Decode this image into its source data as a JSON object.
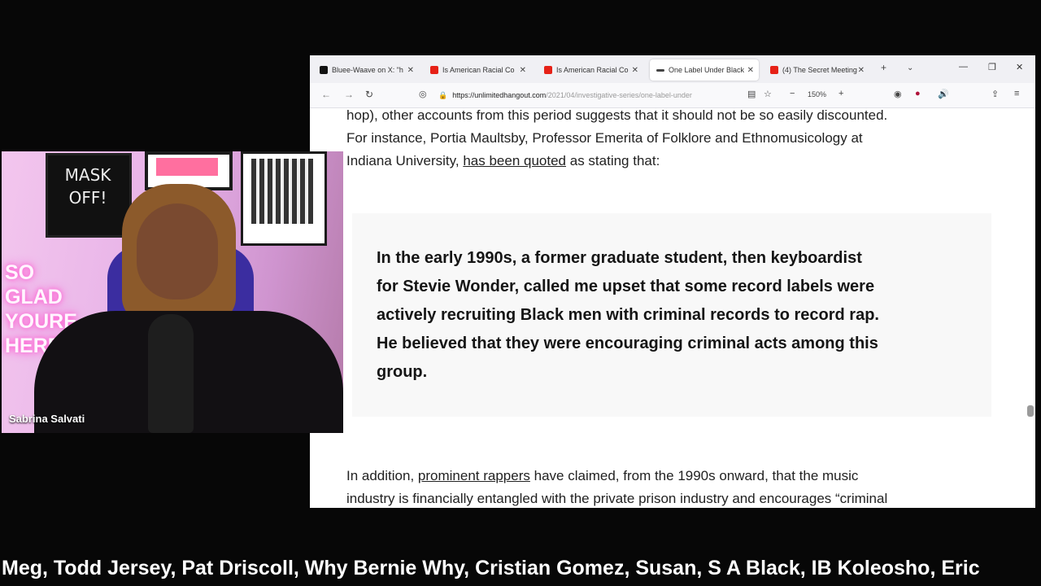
{
  "browser": {
    "tabs": [
      {
        "title": "Bluee-Waave on X: \"h",
        "favicon": "x-logo",
        "color": "#111111",
        "active": false
      },
      {
        "title": "Is American Racial Co",
        "favicon": "youtube-logo",
        "color": "#e62117",
        "active": false
      },
      {
        "title": "Is American Racial Co",
        "favicon": "youtube-logo",
        "color": "#e62117",
        "active": false
      },
      {
        "title": "One Label Under Black",
        "favicon": "unlimited-hangout-logo",
        "color": "#444444",
        "active": true
      },
      {
        "title": "(4) The Secret Meeting",
        "favicon": "youtube-logo",
        "color": "#e62117",
        "active": false
      }
    ],
    "url_host": "https://unlimitedhangout.com",
    "url_path": "/2021/04/investigative-series/one-label-under",
    "zoom": "150%"
  },
  "article": {
    "line1": "hop), other accounts from this period suggests that it should not be so easily discounted.",
    "line2": "For instance, Portia Maultsby, Professor Emerita of Folklore and Ethnomusicology at",
    "line3_pre": "Indiana University,",
    "line3_link": "has been quoted",
    "line3_post": "as stating that:",
    "quote": [
      "In the early 1990s, a former graduate student, then keyboardist",
      "for Stevie Wonder, called me upset that some record labels were",
      "actively recruiting Black men with criminal records to record rap.",
      "He believed that they were encouraging criminal acts among this",
      "group."
    ],
    "line4_pre": "In addition,",
    "line4_link": "prominent rappers",
    "line4_post": "have claimed, from the 1990s onward, that the music",
    "line5": "industry is financially entangled with the private prison industry and encourages “criminal"
  },
  "webcam": {
    "name": "Sabrina Salvati",
    "chalkboard": [
      "MASK",
      "OFF!"
    ],
    "neon": [
      "SO",
      "GLAD",
      "YOURE",
      "HERE"
    ]
  },
  "ticker": "Meg, Todd Jersey, Pat Driscoll, Why Bernie Why, Cristian Gomez, Susan, S A Black, IB Koleosho, Eric"
}
